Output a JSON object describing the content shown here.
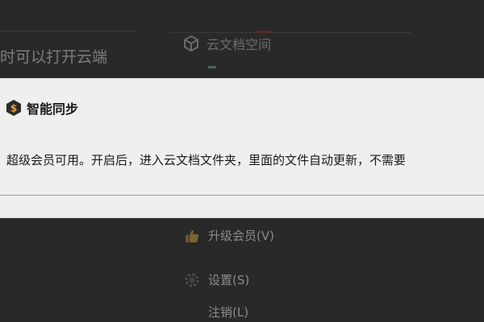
{
  "background": {
    "left_text": "时可以打开云端",
    "cloud_space_label": "云文档空间",
    "menu": [
      {
        "label": "升级会员(V)",
        "icon": "thumb-up-icon"
      },
      {
        "label": "设置(S)",
        "icon": "gear-icon"
      },
      {
        "label": "注销(L)",
        "icon": ""
      }
    ]
  },
  "popup": {
    "title": "智能同步",
    "icon": "dollar-icon",
    "description": "超级会员可用。开启后，进入云文档文件夹，里面的文件自动更新，不需要"
  },
  "colors": {
    "overlay": "#282828",
    "popup_bg": "#efefef",
    "icon_bg": "#2e2a26",
    "icon_accent": "#e8a33a"
  }
}
